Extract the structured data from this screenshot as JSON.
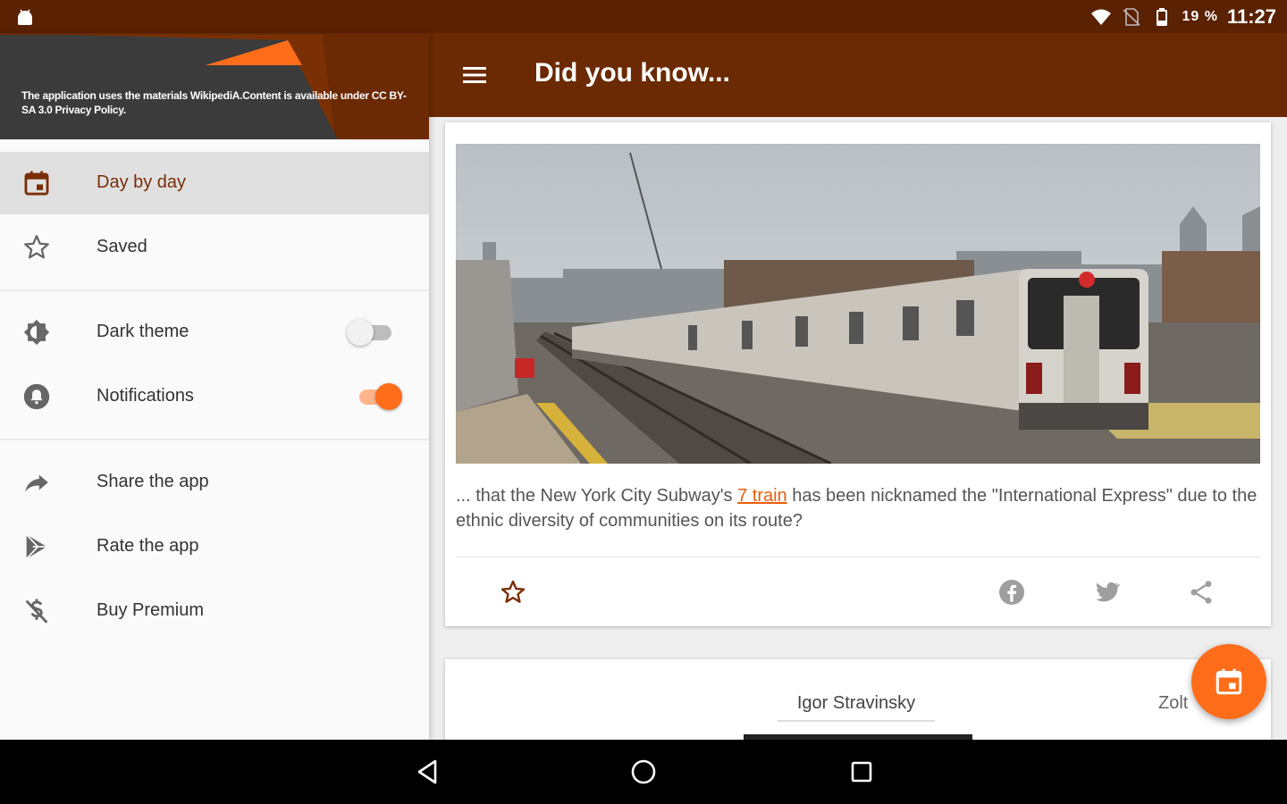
{
  "status_bar": {
    "battery": "19 %",
    "time": "11:27"
  },
  "drawer": {
    "header_text": "The application uses the materials WikipediA.Content is available under CC BY-SA 3.0 Privacy Policy.",
    "items": [
      {
        "label": "Day by day",
        "icon": "calendar-icon",
        "active": true
      },
      {
        "label": "Saved",
        "icon": "star-outline-icon"
      }
    ],
    "settings": [
      {
        "label": "Dark theme",
        "icon": "brightness-icon",
        "toggle": false
      },
      {
        "label": "Notifications",
        "icon": "bell-icon",
        "toggle": true
      }
    ],
    "actions": [
      {
        "label": "Share the app",
        "icon": "share-arrow-icon"
      },
      {
        "label": "Rate the app",
        "icon": "play-store-icon"
      },
      {
        "label": "Buy Premium",
        "icon": "no-money-icon"
      }
    ]
  },
  "app_bar": {
    "title": "Did you know..."
  },
  "fact_card": {
    "text_before": "... that the New York City Subway's ",
    "link": "7 train",
    "text_after": " has been nicknamed the \"International Express\" due to the ethnic diversity of communities on its route?"
  },
  "tabs_card": {
    "tabs": [
      "Igor Stravinsky",
      "Zolt"
    ]
  },
  "colors": {
    "primary": "#6b2a03",
    "status_bar": "#5a2103",
    "accent": "#ff6d1a",
    "link": "#e85d0c"
  }
}
